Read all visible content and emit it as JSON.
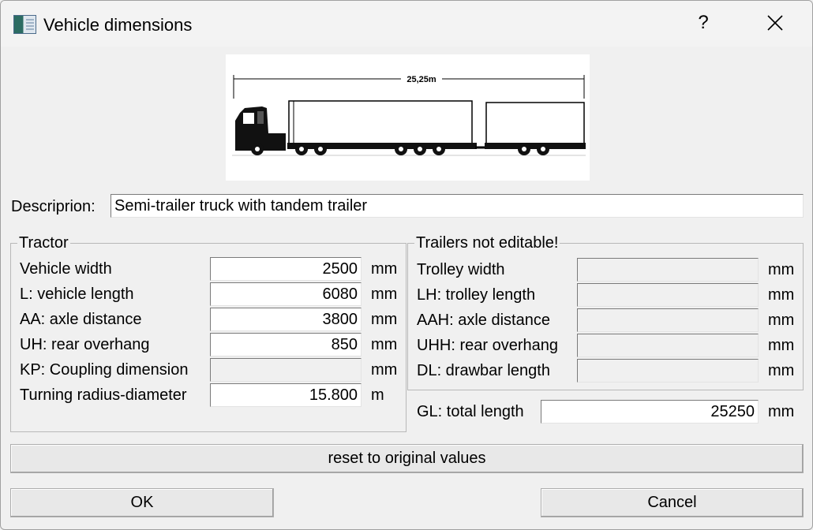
{
  "window": {
    "title": "Vehicle dimensions",
    "help_label": "?",
    "icon": "app-icon",
    "close_icon": "close-icon"
  },
  "picture": {
    "dimension_label": "25,25m",
    "icon": "truck-with-trailer-illustration"
  },
  "description": {
    "label": "Descriprion:",
    "value": "Semi-trailer truck with tandem trailer"
  },
  "tractor": {
    "title": "Tractor",
    "rows": [
      {
        "label": "Vehicle width",
        "value": "2500",
        "unit": "mm"
      },
      {
        "label": "L: vehicle length",
        "value": "6080",
        "unit": "mm"
      },
      {
        "label": "AA: axle distance",
        "value": "3800",
        "unit": "mm"
      },
      {
        "label": "UH: rear overhang",
        "value": "850",
        "unit": "mm"
      },
      {
        "label": "KP: Coupling dimension",
        "value": "",
        "unit": "mm"
      },
      {
        "label": "Turning radius-diameter",
        "value": "15.800",
        "unit": "m"
      }
    ]
  },
  "trailers": {
    "title": "Trailers not editable!",
    "rows": [
      {
        "label": "Trolley width",
        "value": "",
        "unit": "mm"
      },
      {
        "label": "LH: trolley length",
        "value": "",
        "unit": "mm"
      },
      {
        "label": "AAH: axle distance",
        "value": "",
        "unit": "mm"
      },
      {
        "label": "UHH: rear overhang",
        "value": "",
        "unit": "mm"
      },
      {
        "label": "DL: drawbar length",
        "value": "",
        "unit": "mm"
      }
    ]
  },
  "total": {
    "label": "GL: total length",
    "value": "25250",
    "unit": "mm"
  },
  "buttons": {
    "reset": "reset to original values",
    "ok": "OK",
    "cancel": "Cancel"
  }
}
